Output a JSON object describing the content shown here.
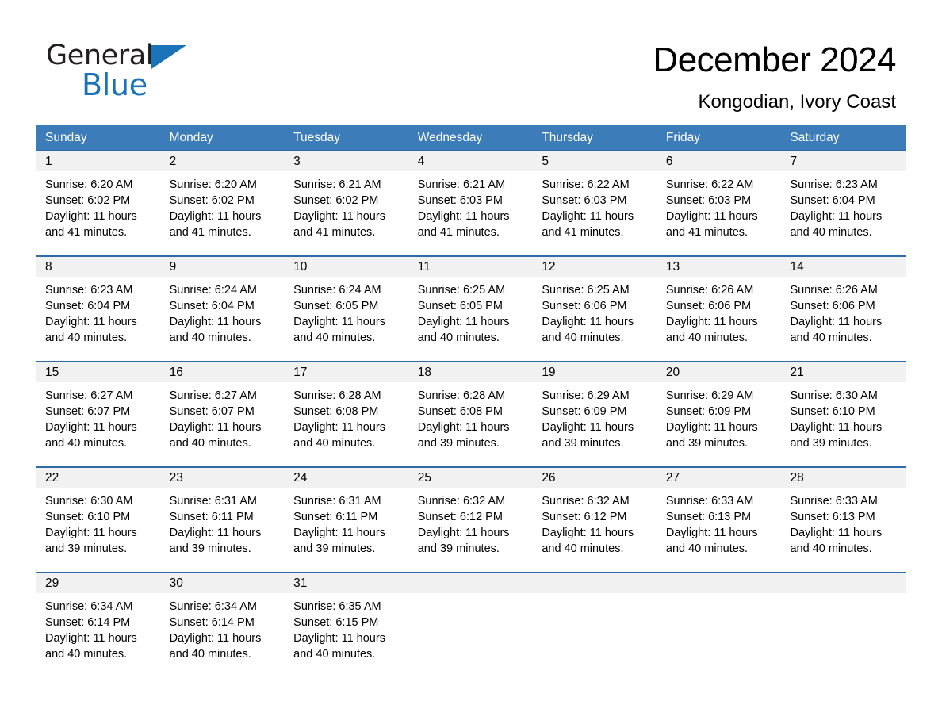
{
  "brand": {
    "word1": "General",
    "word2": "Blue",
    "triangle_color": "#1a72b8",
    "icon": "triangle-logo-icon"
  },
  "header": {
    "title": "December 2024",
    "subtitle": "Kongodian, Ivory Coast"
  },
  "colors": {
    "header_blue": "#3b7cb9",
    "row_divider_blue": "#2d6ca8",
    "day_band_gray": "#f1f1f1",
    "brand_blue": "#1a72b8"
  },
  "calendar": {
    "weekdays": [
      "Sunday",
      "Monday",
      "Tuesday",
      "Wednesday",
      "Thursday",
      "Friday",
      "Saturday"
    ],
    "weeks": [
      [
        {
          "day": "1",
          "sunrise": "Sunrise: 6:20 AM",
          "sunset": "Sunset: 6:02 PM",
          "daylight": "Daylight: 11 hours and 41 minutes."
        },
        {
          "day": "2",
          "sunrise": "Sunrise: 6:20 AM",
          "sunset": "Sunset: 6:02 PM",
          "daylight": "Daylight: 11 hours and 41 minutes."
        },
        {
          "day": "3",
          "sunrise": "Sunrise: 6:21 AM",
          "sunset": "Sunset: 6:02 PM",
          "daylight": "Daylight: 11 hours and 41 minutes."
        },
        {
          "day": "4",
          "sunrise": "Sunrise: 6:21 AM",
          "sunset": "Sunset: 6:03 PM",
          "daylight": "Daylight: 11 hours and 41 minutes."
        },
        {
          "day": "5",
          "sunrise": "Sunrise: 6:22 AM",
          "sunset": "Sunset: 6:03 PM",
          "daylight": "Daylight: 11 hours and 41 minutes."
        },
        {
          "day": "6",
          "sunrise": "Sunrise: 6:22 AM",
          "sunset": "Sunset: 6:03 PM",
          "daylight": "Daylight: 11 hours and 41 minutes."
        },
        {
          "day": "7",
          "sunrise": "Sunrise: 6:23 AM",
          "sunset": "Sunset: 6:04 PM",
          "daylight": "Daylight: 11 hours and 40 minutes."
        }
      ],
      [
        {
          "day": "8",
          "sunrise": "Sunrise: 6:23 AM",
          "sunset": "Sunset: 6:04 PM",
          "daylight": "Daylight: 11 hours and 40 minutes."
        },
        {
          "day": "9",
          "sunrise": "Sunrise: 6:24 AM",
          "sunset": "Sunset: 6:04 PM",
          "daylight": "Daylight: 11 hours and 40 minutes."
        },
        {
          "day": "10",
          "sunrise": "Sunrise: 6:24 AM",
          "sunset": "Sunset: 6:05 PM",
          "daylight": "Daylight: 11 hours and 40 minutes."
        },
        {
          "day": "11",
          "sunrise": "Sunrise: 6:25 AM",
          "sunset": "Sunset: 6:05 PM",
          "daylight": "Daylight: 11 hours and 40 minutes."
        },
        {
          "day": "12",
          "sunrise": "Sunrise: 6:25 AM",
          "sunset": "Sunset: 6:06 PM",
          "daylight": "Daylight: 11 hours and 40 minutes."
        },
        {
          "day": "13",
          "sunrise": "Sunrise: 6:26 AM",
          "sunset": "Sunset: 6:06 PM",
          "daylight": "Daylight: 11 hours and 40 minutes."
        },
        {
          "day": "14",
          "sunrise": "Sunrise: 6:26 AM",
          "sunset": "Sunset: 6:06 PM",
          "daylight": "Daylight: 11 hours and 40 minutes."
        }
      ],
      [
        {
          "day": "15",
          "sunrise": "Sunrise: 6:27 AM",
          "sunset": "Sunset: 6:07 PM",
          "daylight": "Daylight: 11 hours and 40 minutes."
        },
        {
          "day": "16",
          "sunrise": "Sunrise: 6:27 AM",
          "sunset": "Sunset: 6:07 PM",
          "daylight": "Daylight: 11 hours and 40 minutes."
        },
        {
          "day": "17",
          "sunrise": "Sunrise: 6:28 AM",
          "sunset": "Sunset: 6:08 PM",
          "daylight": "Daylight: 11 hours and 40 minutes."
        },
        {
          "day": "18",
          "sunrise": "Sunrise: 6:28 AM",
          "sunset": "Sunset: 6:08 PM",
          "daylight": "Daylight: 11 hours and 39 minutes."
        },
        {
          "day": "19",
          "sunrise": "Sunrise: 6:29 AM",
          "sunset": "Sunset: 6:09 PM",
          "daylight": "Daylight: 11 hours and 39 minutes."
        },
        {
          "day": "20",
          "sunrise": "Sunrise: 6:29 AM",
          "sunset": "Sunset: 6:09 PM",
          "daylight": "Daylight: 11 hours and 39 minutes."
        },
        {
          "day": "21",
          "sunrise": "Sunrise: 6:30 AM",
          "sunset": "Sunset: 6:10 PM",
          "daylight": "Daylight: 11 hours and 39 minutes."
        }
      ],
      [
        {
          "day": "22",
          "sunrise": "Sunrise: 6:30 AM",
          "sunset": "Sunset: 6:10 PM",
          "daylight": "Daylight: 11 hours and 39 minutes."
        },
        {
          "day": "23",
          "sunrise": "Sunrise: 6:31 AM",
          "sunset": "Sunset: 6:11 PM",
          "daylight": "Daylight: 11 hours and 39 minutes."
        },
        {
          "day": "24",
          "sunrise": "Sunrise: 6:31 AM",
          "sunset": "Sunset: 6:11 PM",
          "daylight": "Daylight: 11 hours and 39 minutes."
        },
        {
          "day": "25",
          "sunrise": "Sunrise: 6:32 AM",
          "sunset": "Sunset: 6:12 PM",
          "daylight": "Daylight: 11 hours and 39 minutes."
        },
        {
          "day": "26",
          "sunrise": "Sunrise: 6:32 AM",
          "sunset": "Sunset: 6:12 PM",
          "daylight": "Daylight: 11 hours and 40 minutes."
        },
        {
          "day": "27",
          "sunrise": "Sunrise: 6:33 AM",
          "sunset": "Sunset: 6:13 PM",
          "daylight": "Daylight: 11 hours and 40 minutes."
        },
        {
          "day": "28",
          "sunrise": "Sunrise: 6:33 AM",
          "sunset": "Sunset: 6:13 PM",
          "daylight": "Daylight: 11 hours and 40 minutes."
        }
      ],
      [
        {
          "day": "29",
          "sunrise": "Sunrise: 6:34 AM",
          "sunset": "Sunset: 6:14 PM",
          "daylight": "Daylight: 11 hours and 40 minutes."
        },
        {
          "day": "30",
          "sunrise": "Sunrise: 6:34 AM",
          "sunset": "Sunset: 6:14 PM",
          "daylight": "Daylight: 11 hours and 40 minutes."
        },
        {
          "day": "31",
          "sunrise": "Sunrise: 6:35 AM",
          "sunset": "Sunset: 6:15 PM",
          "daylight": "Daylight: 11 hours and 40 minutes."
        },
        {
          "day": "",
          "sunrise": "",
          "sunset": "",
          "daylight": ""
        },
        {
          "day": "",
          "sunrise": "",
          "sunset": "",
          "daylight": ""
        },
        {
          "day": "",
          "sunrise": "",
          "sunset": "",
          "daylight": ""
        },
        {
          "day": "",
          "sunrise": "",
          "sunset": "",
          "daylight": ""
        }
      ]
    ]
  }
}
